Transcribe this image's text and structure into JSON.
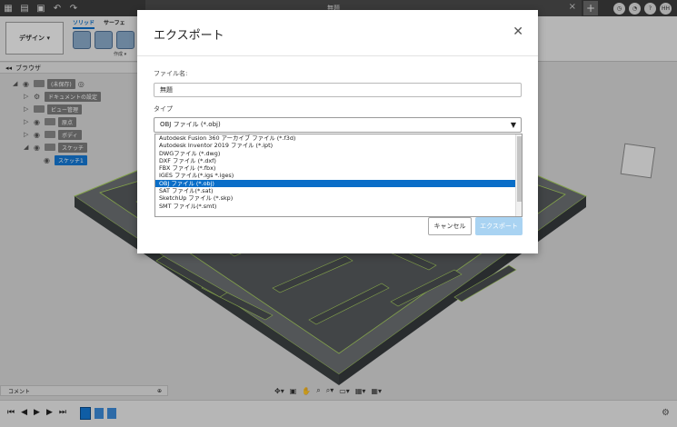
{
  "titlebar": {
    "file_tab_label": "無題"
  },
  "toolbar": {
    "design_label": "デザイン ▾",
    "tabs": [
      "ソリッド",
      "サーフェ"
    ],
    "sub_label": "作成 ▾"
  },
  "browser": {
    "header": "ブラウザ",
    "items": [
      {
        "label": "(未保存)"
      },
      {
        "label": "ドキュメントの設定"
      },
      {
        "label": "ビュー管理"
      },
      {
        "label": "原点"
      },
      {
        "label": "ボディ"
      },
      {
        "label": "スケッチ"
      },
      {
        "label": "スケッチ1"
      }
    ]
  },
  "comments": {
    "label": "コメント"
  },
  "user": {
    "initials": "HH"
  },
  "dialog": {
    "title": "エクスポート",
    "file_name_label": "ファイル名:",
    "file_name_value": "無題",
    "type_label": "タイプ",
    "type_selected": "OBJ ファイル (*.obj)",
    "type_options": [
      "Autodesk Fusion 360 アーカイブ ファイル (*.f3d)",
      "Autodesk Inventor 2019 ファイル (*.ipt)",
      "DWGファイル (*.dwg)",
      "DXF ファイル (*.dxf)",
      "FBX ファイル (*.fbx)",
      "IGES ファイル(*.igs *.iges)",
      "OBJ ファイル (*.obj)",
      "SAT ファイル(*.sat)",
      "SketchUp ファイル (*.skp)",
      "SMT ファイル(*.smt)"
    ],
    "highlighted_index": 6,
    "cancel_label": "キャンセル",
    "export_label": "エクスポート"
  },
  "colors": {
    "accent": "#0a6ec8",
    "export_disabled": "#a9d3f2",
    "maze_wall": "#4a4e50",
    "maze_edge": "#a8d060"
  }
}
